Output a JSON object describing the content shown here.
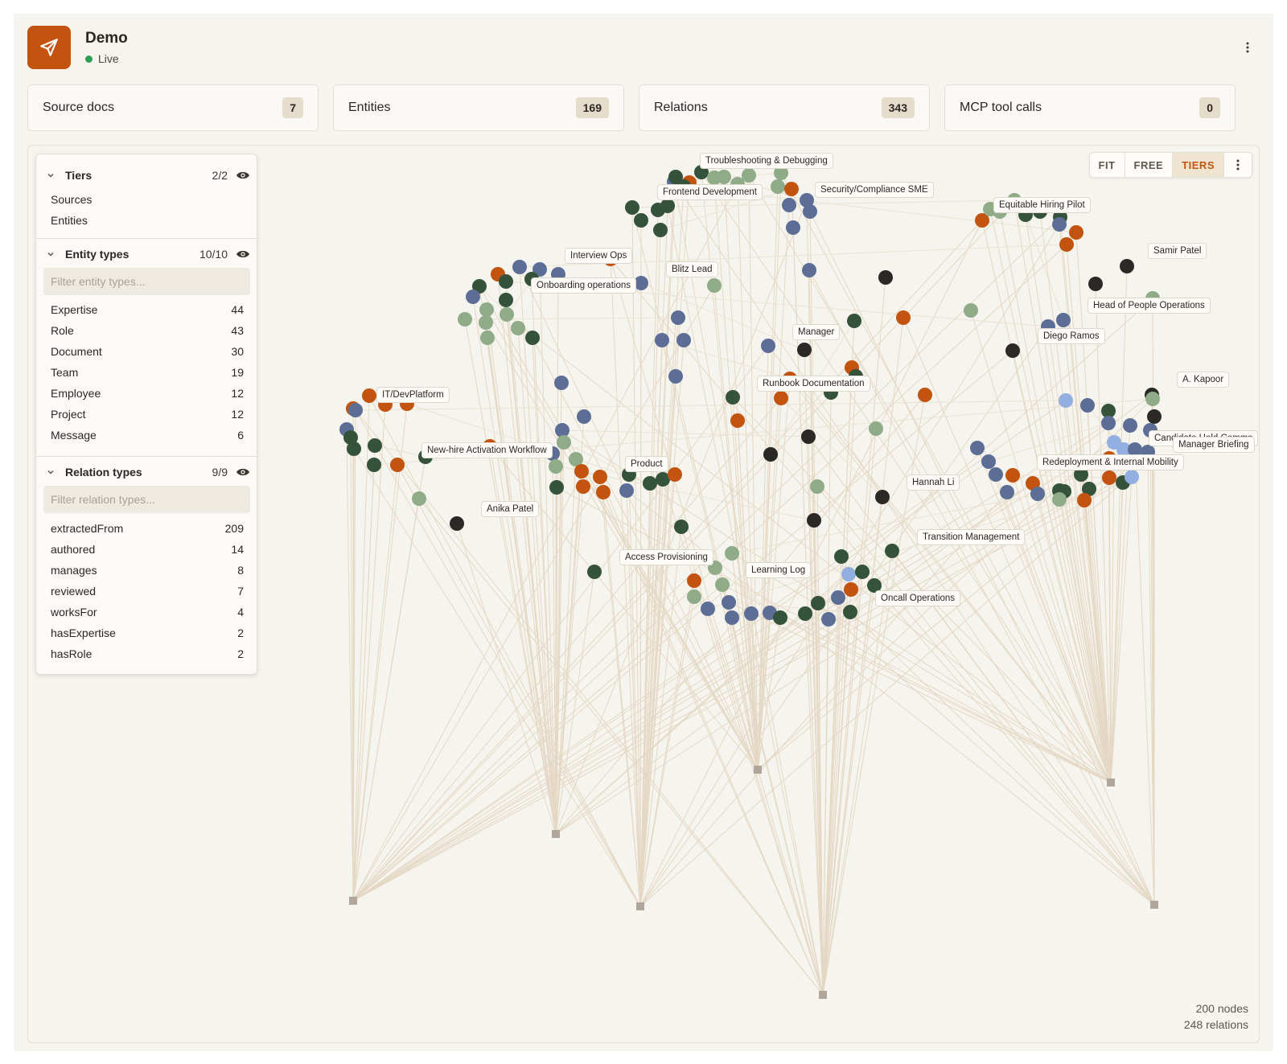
{
  "app": {
    "title": "Demo",
    "status": "Live"
  },
  "stats": [
    {
      "label": "Source docs",
      "count": "7"
    },
    {
      "label": "Entities",
      "count": "169"
    },
    {
      "label": "Relations",
      "count": "343"
    },
    {
      "label": "MCP tool calls",
      "count": "0"
    }
  ],
  "sidebar": {
    "tiers": {
      "title": "Tiers",
      "count": "2/2",
      "items": [
        "Sources",
        "Entities"
      ]
    },
    "entity_types": {
      "title": "Entity types",
      "count": "10/10",
      "filter_placeholder": "Filter entity types...",
      "items": [
        {
          "label": "Expertise",
          "count": "44"
        },
        {
          "label": "Role",
          "count": "43"
        },
        {
          "label": "Document",
          "count": "30"
        },
        {
          "label": "Team",
          "count": "19"
        },
        {
          "label": "Employee",
          "count": "12"
        },
        {
          "label": "Project",
          "count": "12"
        },
        {
          "label": "Message",
          "count": "6"
        }
      ]
    },
    "relation_types": {
      "title": "Relation types",
      "count": "9/9",
      "filter_placeholder": "Filter relation types...",
      "items": [
        {
          "label": "extractedFrom",
          "count": "209"
        },
        {
          "label": "authored",
          "count": "14"
        },
        {
          "label": "manages",
          "count": "8"
        },
        {
          "label": "reviewed",
          "count": "7"
        },
        {
          "label": "worksFor",
          "count": "4"
        },
        {
          "label": "hasExpertise",
          "count": "2"
        },
        {
          "label": "hasRole",
          "count": "2"
        }
      ]
    }
  },
  "toolbar": {
    "fit": "FIT",
    "free": "FREE",
    "tiers": "TIERS",
    "active": "TIERS"
  },
  "graph": {
    "nodes_text": "200 nodes",
    "relations_text": "248 relations",
    "labels": [
      "Troubleshooting & Debugging",
      "Frontend Development",
      "Security/Compliance SME",
      "Equitable Hiring Pilot",
      "Samir Patel",
      "Interview Ops",
      "Onboarding operations",
      "Blitz Lead",
      "Head of People Operations",
      "Diego Ramos",
      "Manager",
      "Runbook Documentation",
      "A. Kapoor",
      "IT/DevPlatform",
      "Candidate Hold Comms",
      "Manager Briefing",
      "New-hire Activation Workflow",
      "Product",
      "Redeployment & Internal Mobility",
      "Hannah Li",
      "Anika Patel",
      "Transition Management",
      "Access Provisioning",
      "Learning Log",
      "Oncall Operations"
    ]
  },
  "colors": {
    "brand": "#c2540f",
    "live": "#2f9e58",
    "node_dark_green": "#35533a",
    "node_sage": "#8fab88",
    "node_slate_blue": "#5c6e96",
    "node_orange": "#c2540f",
    "node_charcoal": "#2a2925",
    "node_light_blue": "#93aee0",
    "edge": "#e4d8c4",
    "source_square": "#b0a79a"
  }
}
